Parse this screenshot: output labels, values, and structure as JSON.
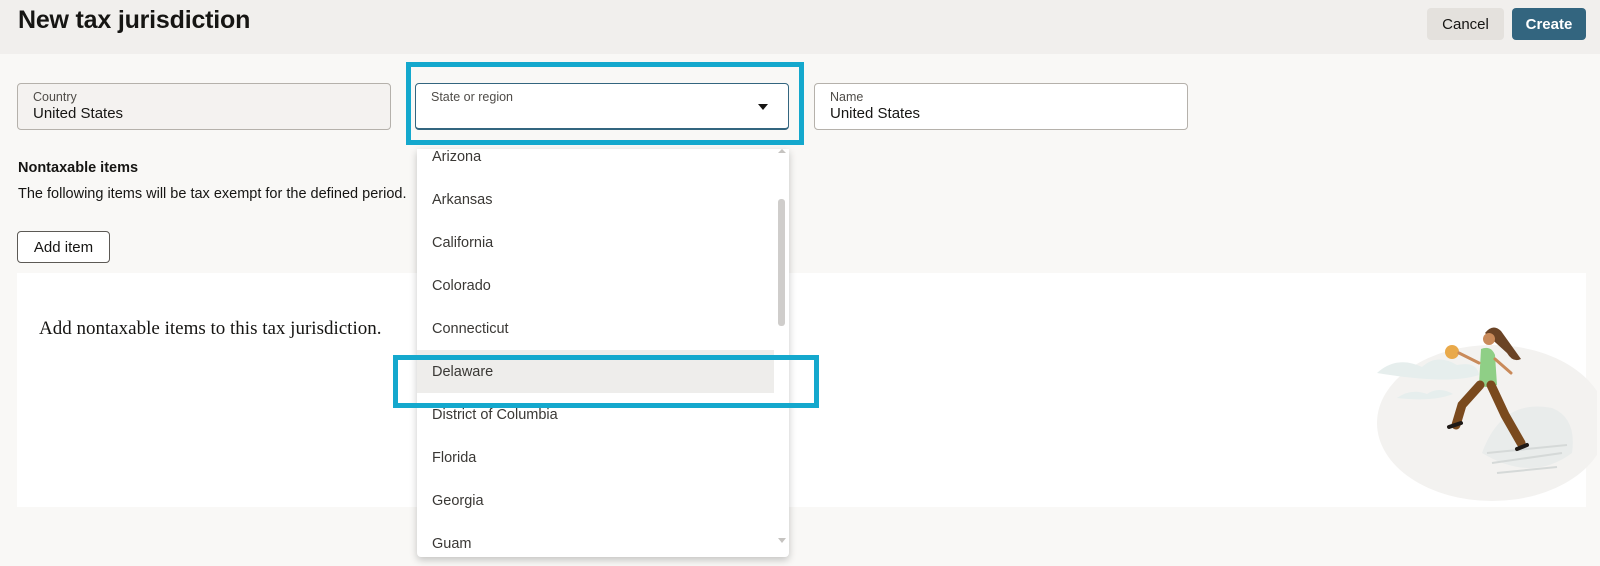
{
  "header": {
    "title": "New tax jurisdiction",
    "cancel_label": "Cancel",
    "create_label": "Create"
  },
  "form": {
    "country": {
      "label": "Country",
      "value": "United States"
    },
    "state": {
      "label": "State or region",
      "value": ""
    },
    "name": {
      "label": "Name",
      "value": "United States"
    }
  },
  "nontaxable": {
    "title": "Nontaxable items",
    "description": "The following items will be tax exempt for the defined period.",
    "add_label": "Add item",
    "empty_message": "Add nontaxable items to this tax jurisdiction."
  },
  "dropdown": {
    "options": [
      {
        "label": "Arizona"
      },
      {
        "label": "Arkansas"
      },
      {
        "label": "California"
      },
      {
        "label": "Colorado"
      },
      {
        "label": "Connecticut"
      },
      {
        "label": "Delaware"
      },
      {
        "label": "District of Columbia"
      },
      {
        "label": "Florida"
      },
      {
        "label": "Georgia"
      },
      {
        "label": "Guam"
      }
    ],
    "highlighted": "Delaware"
  },
  "colors": {
    "accent": "#33657f",
    "annotation": "#14a8cd"
  },
  "icons": {
    "state_toggle": "caret-down-icon",
    "illustration": "hiker-illustration"
  }
}
